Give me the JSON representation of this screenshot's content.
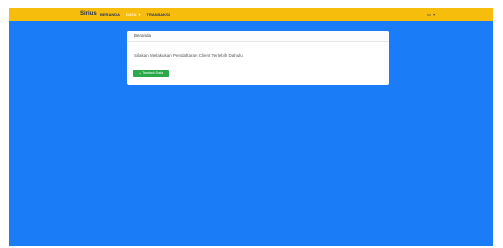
{
  "navbar": {
    "brand": "Sirius",
    "items": [
      {
        "label": "BERANDA"
      },
      {
        "label": "DATA"
      },
      {
        "label": "TRANSAKSI"
      }
    ],
    "user_label": "xx",
    "colors": {
      "background": "#f7bd0d",
      "text": "#233463",
      "active_text": "#fff4d2"
    }
  },
  "main": {
    "background": "#1a7cf7",
    "card": {
      "title": "Beranda",
      "message": "Silakan Melakukan Pendaftaran Client Terlebih Dahulu",
      "button_label": "Tambah Data",
      "button_icon": "plus-icon",
      "button_color": "#2aa84a"
    }
  }
}
